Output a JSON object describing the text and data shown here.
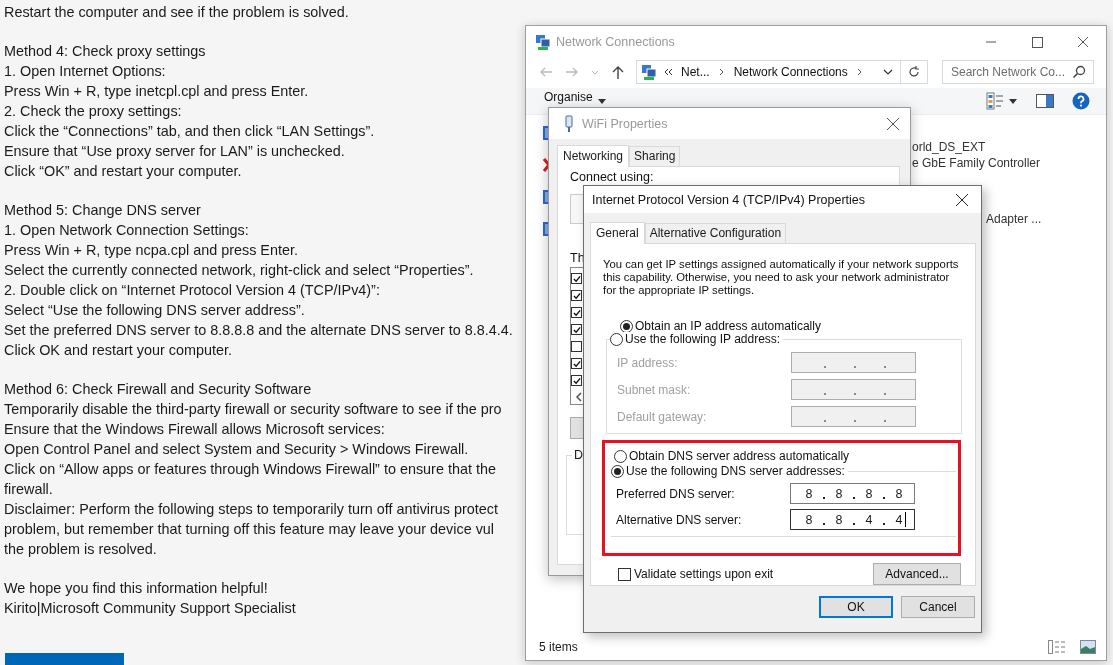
{
  "article": {
    "paragraphs": [
      [
        "Restart the computer and see if the problem is solved."
      ],
      [
        "Method 4: Check proxy settings",
        "1. Open Internet Options:",
        "Press Win + R, type inetcpl.cpl and press Enter.",
        "2. Check the proxy settings:",
        "Click the “Connections” tab, and then click “LAN Settings”.",
        "Ensure that “Use proxy server for LAN” is unchecked.",
        "Click “OK” and restart your computer."
      ],
      [
        "Method 5: Change DNS server",
        "1. Open Network Connection Settings:",
        "Press Win + R, type ncpa.cpl and press Enter.",
        "Select the currently connected network, right-click and select “Properties”.",
        "2. Double click on “Internet Protocol Version 4 (TCP/IPv4)”:",
        "Select “Use the following DNS server address”.",
        "Set the preferred DNS server to 8.8.8.8 and the alternate DNS server to 8.8.4.4.",
        "Click OK and restart your computer."
      ],
      [
        "Method 6: Check Firewall and Security Software",
        "Temporarily disable the third-party firewall or security software to see if the pro",
        "Ensure that the Windows Firewall allows Microsoft services:",
        "Open Control Panel and select System and Security > Windows Firewall.",
        "Click on “Allow apps or features through Windows Firewall” to ensure that the",
        "firewall.",
        "Disclaimer: Perform the following steps to temporarily turn off antivirus protect",
        "problem, but remember that turning off this feature may leave your device vul",
        "the problem is resolved."
      ],
      [
        "We hope you find this information helpful!",
        "Kirito|Microsoft Community Support Specialist"
      ]
    ]
  },
  "explorer": {
    "title": "Network Connections",
    "active": false,
    "breadcrumbs": [
      "Net...",
      "Network Connections"
    ],
    "search": {
      "placeholder": "Search Network Co..."
    },
    "organise": "Organise",
    "connections": [
      {
        "disconnected": false
      },
      {
        "disconnected": true
      },
      {
        "disconnected": false
      },
      {
        "disconnected": false
      }
    ],
    "details": [
      [
        "orld_DS_EXT",
        "e GbE Family Controller"
      ],
      [
        "Adapter ..."
      ]
    ],
    "status": "5 items"
  },
  "wifi": {
    "title": "WiFi Properties",
    "active": false,
    "tabs": [
      {
        "label": "Networking",
        "selected": true
      },
      {
        "label": "Sharing",
        "selected": false
      }
    ],
    "connect_label": "Connect using:",
    "list_label": "Th",
    "components": [
      {
        "checked": true
      },
      {
        "checked": true
      },
      {
        "checked": true
      },
      {
        "checked": true
      },
      {
        "checked": false
      },
      {
        "checked": true
      },
      {
        "checked": true
      }
    ],
    "group_label": "D"
  },
  "ipv4": {
    "title": "Internet Protocol Version 4 (TCP/IPv4) Properties",
    "active": true,
    "tabs": [
      {
        "label": "General",
        "selected": true
      },
      {
        "label": "Alternative Configuration",
        "selected": false
      }
    ],
    "description_lines": [
      "You can get IP settings assigned automatically if your network supports",
      "this capability. Otherwise, you need to ask your network administrator",
      "for the appropriate IP settings."
    ],
    "ip_mode": [
      {
        "label": "Obtain an IP address automatically",
        "selected": true
      },
      {
        "label": "Use the following IP address:",
        "selected": false
      }
    ],
    "ip_fields": [
      {
        "label": "IP address:",
        "disabled": true
      },
      {
        "label": "Subnet mask:",
        "disabled": true
      },
      {
        "label": "Default gateway:",
        "disabled": true
      }
    ],
    "dns_highlighted": true,
    "dns_mode": [
      {
        "label": "Obtain DNS server address automatically",
        "selected": false
      },
      {
        "label": "Use the following DNS server addresses:",
        "selected": true
      }
    ],
    "dns_fields": [
      {
        "label": "Preferred DNS server:",
        "octets": [
          "8",
          "8",
          "8",
          "8"
        ],
        "focused": false
      },
      {
        "label": "Alternative DNS server:",
        "octets": [
          "8",
          "8",
          "4",
          "4"
        ],
        "focused": true
      }
    ],
    "validate": {
      "label": "Validate settings upon exit",
      "checked": false
    },
    "advanced": "Advanced...",
    "buttons": [
      {
        "label": "OK",
        "default": true
      },
      {
        "label": "Cancel",
        "default": false
      }
    ]
  }
}
